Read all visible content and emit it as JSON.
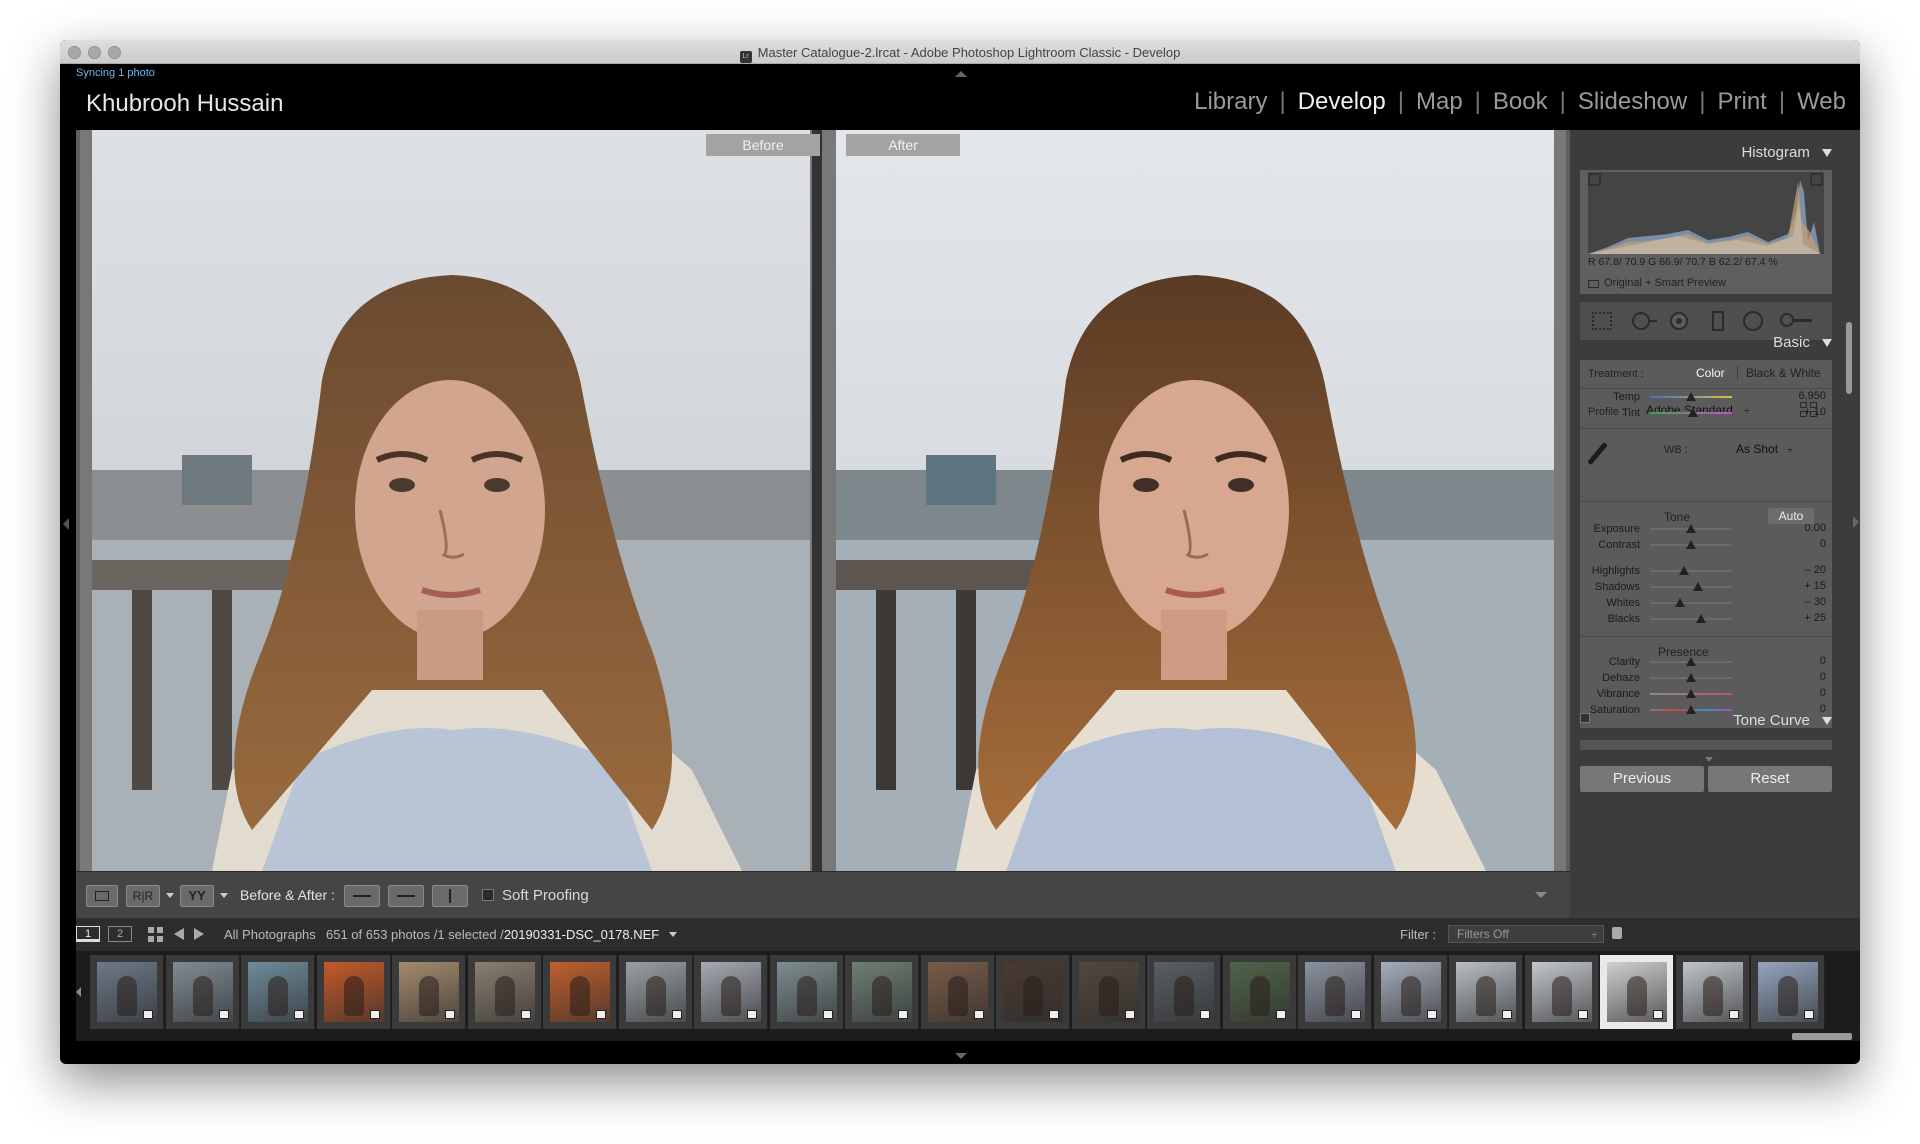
{
  "window": {
    "title": "Master Catalogue-2.lrcat - Adobe Photoshop Lightroom Classic - Develop",
    "app_badge": "Lr"
  },
  "identity": {
    "status": "Syncing 1 photo",
    "name": "Khubrooh Hussain"
  },
  "modules": [
    "Library",
    "Develop",
    "Map",
    "Book",
    "Slideshow",
    "Print",
    "Web"
  ],
  "active_module": "Develop",
  "view": {
    "before_label": "Before",
    "after_label": "After"
  },
  "toolbar": {
    "before_after_label": "Before & After :",
    "soft_proofing_label": "Soft Proofing",
    "soft_proofing_checked": false,
    "ab_view_icon_text": "YY",
    "rr_icon_text": "R|R"
  },
  "histogram": {
    "title": "Histogram",
    "readout": "R  67.8/ 70.9   G  66.9/ 70.7   B  62.2/ 67.4 %",
    "preview_label": "Original + Smart Preview"
  },
  "basic": {
    "title": "Basic",
    "treatment_label": "Treatment :",
    "treatment_options": [
      "Color",
      "Black & White"
    ],
    "treatment_selected": "Color",
    "profile_label": "Profile :",
    "profile_value": "Adobe Standard",
    "profile_suffix": "÷",
    "wb_label": "WB :",
    "wb_value": "As Shot",
    "wb_suffix": "÷",
    "tone_label": "Tone",
    "auto_label": "Auto",
    "presence_label": "Presence",
    "sliders": {
      "temp": {
        "label": "Temp",
        "value": "6,950",
        "position": 0.5
      },
      "tint": {
        "label": "Tint",
        "value": "+ 10",
        "position": 0.52
      },
      "exposure": {
        "label": "Exposure",
        "value": "0.00",
        "position": 0.5
      },
      "contrast": {
        "label": "Contrast",
        "value": "0",
        "position": 0.5
      },
      "highlights": {
        "label": "Highlights",
        "value": "– 20",
        "position": 0.41
      },
      "shadows": {
        "label": "Shadows",
        "value": "+ 15",
        "position": 0.58
      },
      "whites": {
        "label": "Whites",
        "value": "– 30",
        "position": 0.36
      },
      "blacks": {
        "label": "Blacks",
        "value": "+ 25",
        "position": 0.62
      },
      "clarity": {
        "label": "Clarity",
        "value": "0",
        "position": 0.5
      },
      "dehaze": {
        "label": "Dehaze",
        "value": "0",
        "position": 0.5
      },
      "vibrance": {
        "label": "Vibrance",
        "value": "0",
        "position": 0.5
      },
      "saturation": {
        "label": "Saturation",
        "value": "0",
        "position": 0.5
      }
    }
  },
  "tone_curve": {
    "title": "Tone Curve"
  },
  "buttons": {
    "previous": "Previous",
    "reset": "Reset"
  },
  "filmstrip_bar": {
    "page1": "1",
    "page2": "2",
    "source": "All Photographs",
    "count": "651 of 653 photos /1 selected /",
    "filename": "20190331-DSC_0178.NEF",
    "filter_label": "Filter :",
    "filter_value": "Filters Off"
  },
  "filmstrip": {
    "count": 23,
    "selected_index": 20
  },
  "colors": {
    "accent_sync": "#6fb7ee",
    "panel_bg": "#3c3c3c",
    "section_bg": "#5b5b5b"
  }
}
